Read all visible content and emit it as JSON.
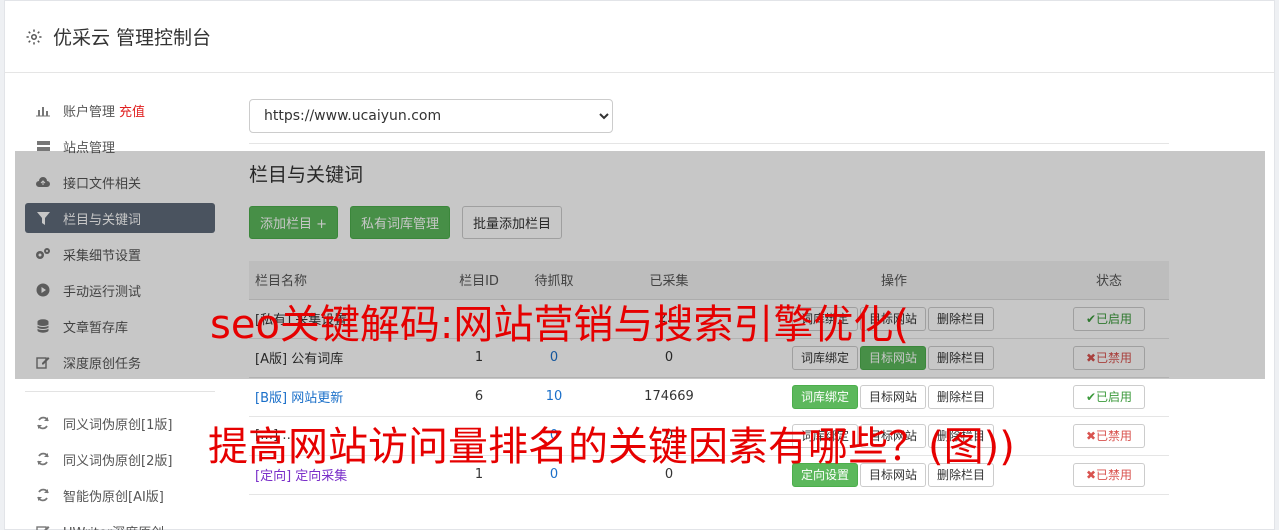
{
  "header": {
    "title": "优采云 管理控制台",
    "icon": "gear-icon"
  },
  "sidebar": {
    "items": [
      {
        "label": "账户管理",
        "extra": "充值",
        "icon": "bar-chart-icon"
      },
      {
        "label": "站点管理",
        "icon": "server-icon"
      },
      {
        "label": "接口文件相关",
        "icon": "cloud-upload-icon"
      },
      {
        "label": "栏目与关键词",
        "icon": "filter-icon",
        "active": true
      },
      {
        "label": "采集细节设置",
        "icon": "gears-icon"
      },
      {
        "label": "手动运行测试",
        "icon": "play-circle-icon"
      },
      {
        "label": "文章暂存库",
        "icon": "database-icon"
      },
      {
        "label": "深度原创任务",
        "icon": "edit-icon"
      }
    ],
    "items2": [
      {
        "label": "同义词伪原创[1版]",
        "icon": "refresh-icon"
      },
      {
        "label": "同义词伪原创[2版]",
        "icon": "refresh-icon"
      },
      {
        "label": "智能伪原创[AI版]",
        "icon": "refresh-icon"
      },
      {
        "label": "UWriter深度原创",
        "icon": "edit-icon"
      }
    ]
  },
  "main": {
    "site_select": "https://www.ucaiyun.com",
    "section_title": "栏目与关键词",
    "buttons": {
      "add": "添加栏目 +",
      "private_lib": "私有词库管理",
      "batch_add": "批量添加栏目"
    },
    "table": {
      "headers": [
        "栏目名称",
        "栏目ID",
        "待抓取",
        "已采集",
        "操作",
        "状态"
      ],
      "rows": [
        {
          "prefix": "[私有]",
          "name": "采集设置",
          "id": "",
          "wait": "",
          "done": "2…",
          "op1": "词库绑定",
          "op2": "目标网站",
          "op3": "删除栏目",
          "status": "✔已启用"
        },
        {
          "prefix": "[A版]",
          "name": "公有词库",
          "id": "1",
          "wait": "0",
          "done": "0",
          "op1": "词库绑定",
          "op2": "目标网站",
          "op3": "删除栏目",
          "status": "✖已禁用"
        },
        {
          "prefix": "[B版]",
          "name": "网站更新",
          "id": "6",
          "wait": "10",
          "done": "174669",
          "op1": "词库绑定",
          "op2": "目标网站",
          "op3": "删除栏目",
          "status": "✔已启用"
        },
        {
          "prefix": "[…]",
          "name": "…",
          "id": "",
          "wait": "0",
          "done": "0",
          "op1": "词库绑定",
          "op2": "目标网站",
          "op3": "删除栏目",
          "status": "✖已禁用"
        },
        {
          "prefix": "[定向]",
          "name": "定向采集",
          "id": "1",
          "wait": "0",
          "done": "0",
          "op1": "定向设置",
          "op2": "目标网站",
          "op3": "删除栏目",
          "status": "✖已禁用"
        }
      ]
    }
  },
  "watermark": {
    "line1": "seo关键解码:网站营销与搜索引擎优化(",
    "line2": "提高网站访问量排名的关键因素有哪些？(图))"
  },
  "colors": {
    "accent_green": "#5cb85c",
    "active_nav": "#5f6b7a",
    "watermark_red": "#e60000",
    "link_blue": "#1a6fc9"
  }
}
